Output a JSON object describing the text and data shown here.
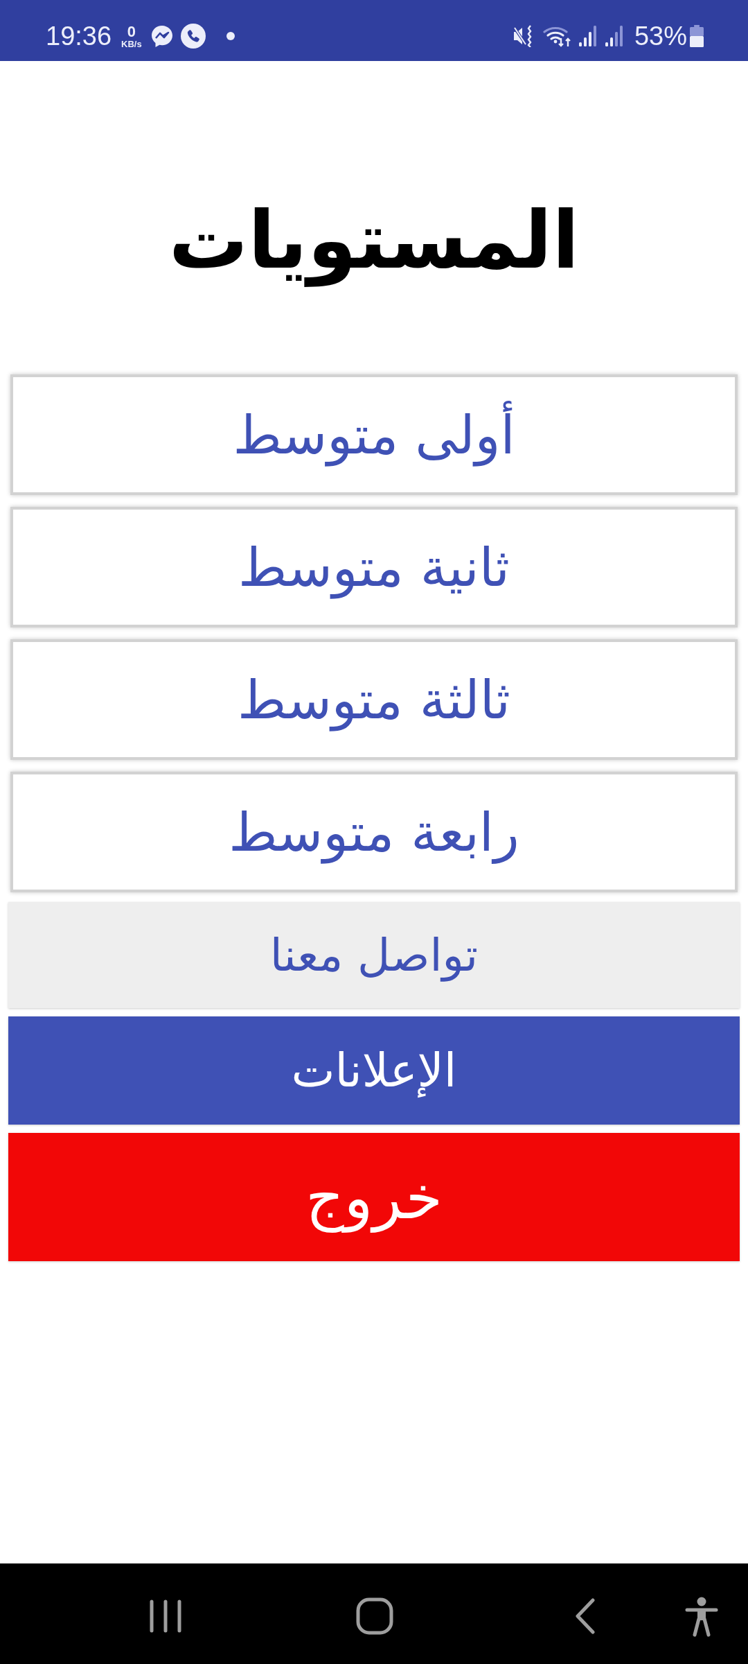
{
  "status_bar": {
    "time": "19:36",
    "net_speed": "0",
    "net_speed_unit": "KB/s",
    "battery_percent": "53%"
  },
  "title": "المستويات",
  "levels": [
    {
      "label": "أولى متوسط"
    },
    {
      "label": "ثانية متوسط"
    },
    {
      "label": "ثالثة متوسط"
    },
    {
      "label": "رابعة متوسط"
    }
  ],
  "buttons": [
    {
      "label": "تواصل معنا",
      "kind": "contact"
    },
    {
      "label": "الإعلانات",
      "kind": "ads"
    },
    {
      "label": "خروج",
      "kind": "exit"
    }
  ]
}
